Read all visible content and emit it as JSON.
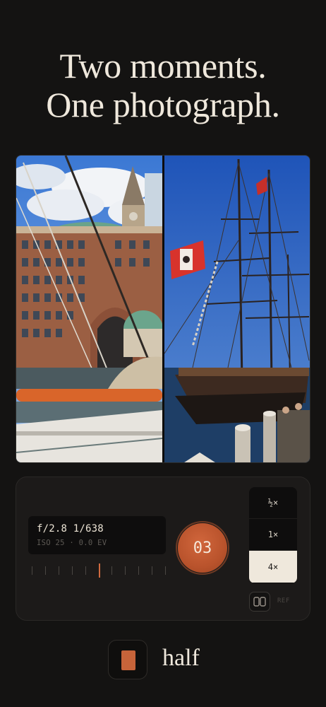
{
  "headline": {
    "line1": "Two moments.",
    "line2": "One photograph."
  },
  "photos": {
    "left": {
      "subject": "harbor-building-with-dome-and-clock-tower"
    },
    "right": {
      "subject": "tall-ship-with-masts-and-red-white-flag"
    }
  },
  "readout": {
    "exposure": "f/2.8 1/638",
    "meta": "ISO 25 · 0.0 EV"
  },
  "ev_ruler": {
    "ticks": 11,
    "active_index": 5
  },
  "shutter": {
    "count": "03"
  },
  "zoom": {
    "options": [
      "½×",
      "1×",
      "4×"
    ],
    "selected": "4×"
  },
  "ref": {
    "label": "REF"
  },
  "brand": {
    "name": "half",
    "accent": "#c7643a"
  },
  "colors": {
    "background": "#141312",
    "accent": "#c7643a",
    "text": "#efe8dc"
  }
}
